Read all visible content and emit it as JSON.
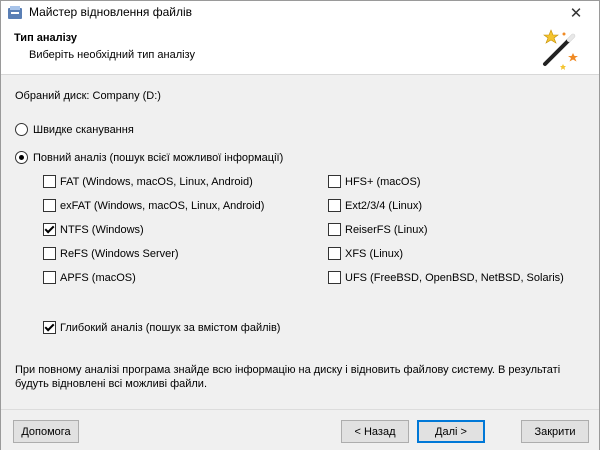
{
  "window": {
    "title": "Майстер відновлення файлів",
    "close_glyph": "✕"
  },
  "header": {
    "title": "Тип аналізу",
    "subtitle": "Виберіть необхідний тип аналізу",
    "icon": "wizard-wand-icon"
  },
  "disk": {
    "label": "Обраний диск: Company (D:)"
  },
  "scan_modes": {
    "quick": {
      "label": "Швидке сканування",
      "selected": false
    },
    "full": {
      "label": "Повний аналіз (пошук всієї можливої інформації)",
      "selected": true
    }
  },
  "filesystems": {
    "left": [
      {
        "label": "FAT (Windows, macOS, Linux, Android)",
        "checked": false
      },
      {
        "label": "exFAT (Windows, macOS, Linux, Android)",
        "checked": false
      },
      {
        "label": "NTFS (Windows)",
        "checked": true
      },
      {
        "label": "ReFS (Windows Server)",
        "checked": false
      },
      {
        "label": "APFS (macOS)",
        "checked": false
      }
    ],
    "right": [
      {
        "label": "HFS+ (macOS)",
        "checked": false
      },
      {
        "label": "Ext2/3/4 (Linux)",
        "checked": false
      },
      {
        "label": "ReiserFS (Linux)",
        "checked": false
      },
      {
        "label": "XFS (Linux)",
        "checked": false
      },
      {
        "label": "UFS (FreeBSD, OpenBSD, NetBSD, Solaris)",
        "checked": false
      }
    ]
  },
  "deep": {
    "label": "Глибокий аналіз (пошук за вмістом файлів)",
    "checked": true
  },
  "info": "При повному аналізі програма знайде всю інформацію на диску і відновить файлову систему. В результаті будуть відновлені всі можливі файли.",
  "buttons": {
    "help": "Допомога",
    "back": "< Назад",
    "next": "Далі >",
    "close": "Закрити"
  }
}
